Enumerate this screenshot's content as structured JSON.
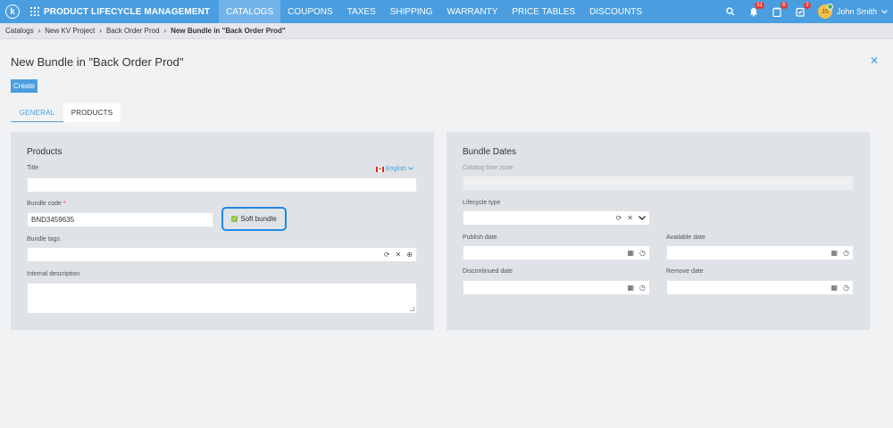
{
  "topbar": {
    "app_title": "PRODUCT LIFECYCLE MANAGEMENT",
    "nav": [
      "CATALOGS",
      "COUPONS",
      "TAXES",
      "SHIPPING",
      "WARRANTY",
      "PRICE TABLES",
      "DISCOUNTS"
    ],
    "active_nav": "CATALOGS",
    "badges": {
      "notifications": "31",
      "tasks": "6",
      "approvals": "3"
    },
    "user": {
      "name": "John Smith",
      "initials": "JS"
    },
    "accent": "#4a9ee0"
  },
  "breadcrumb": [
    "Catalogs",
    "New KV Project",
    "Back Order Prod",
    "New Bundle in \"Back Order Prod\""
  ],
  "page": {
    "title": "New Bundle in \"Back Order Prod\"",
    "create_label": "Create",
    "tabs": [
      "GENERAL",
      "PRODUCTS"
    ]
  },
  "products_panel": {
    "title": "Products",
    "title_label": "Title",
    "language": "English",
    "title_value": "",
    "bundle_code_label": "Bundle code",
    "bundle_code_required": "*",
    "bundle_code_value": "BND3459635",
    "soft_bundle_label": "Soft bundle",
    "soft_bundle_checked": true,
    "bundle_tags_label": "Bundle tags",
    "internal_description_label": "Internal description"
  },
  "dates_panel": {
    "title": "Bundle Dates",
    "catalog_time_zone_label": "Catalog time zone",
    "lifecycle_type_label": "Lifecycle type",
    "publish_date_label": "Publish date",
    "available_date_label": "Available date",
    "discontinued_date_label": "Discontinued date",
    "remove_date_label": "Remove date"
  }
}
